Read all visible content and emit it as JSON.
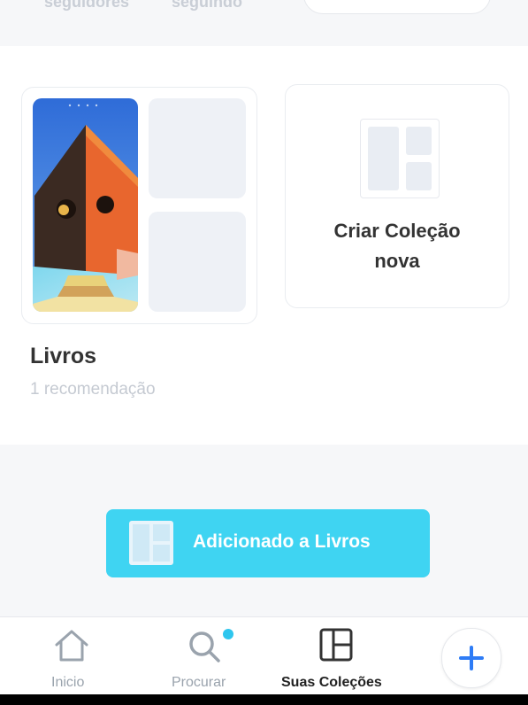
{
  "profile_stats": {
    "followers_label": "seguidores",
    "following_label": "seguindo"
  },
  "collections": [
    {
      "title": "Livros",
      "count_text": "1 recomendação"
    }
  ],
  "create_collection": {
    "label": "Criar Coleção\nnova"
  },
  "toast": {
    "text": "Adicionado a Livros",
    "color": "#3fd4f2"
  },
  "nav": {
    "items": [
      {
        "label": "Inicio",
        "icon": "home-icon"
      },
      {
        "label": "Procurar",
        "icon": "search-icon"
      },
      {
        "label": "Suas Coleções",
        "icon": "collections-icon",
        "active": true
      },
      {
        "label": "",
        "icon": "plus-icon"
      }
    ],
    "active_color": "#222222",
    "inactive_color": "#9aa3ad",
    "accent": "#2e7cf6"
  }
}
